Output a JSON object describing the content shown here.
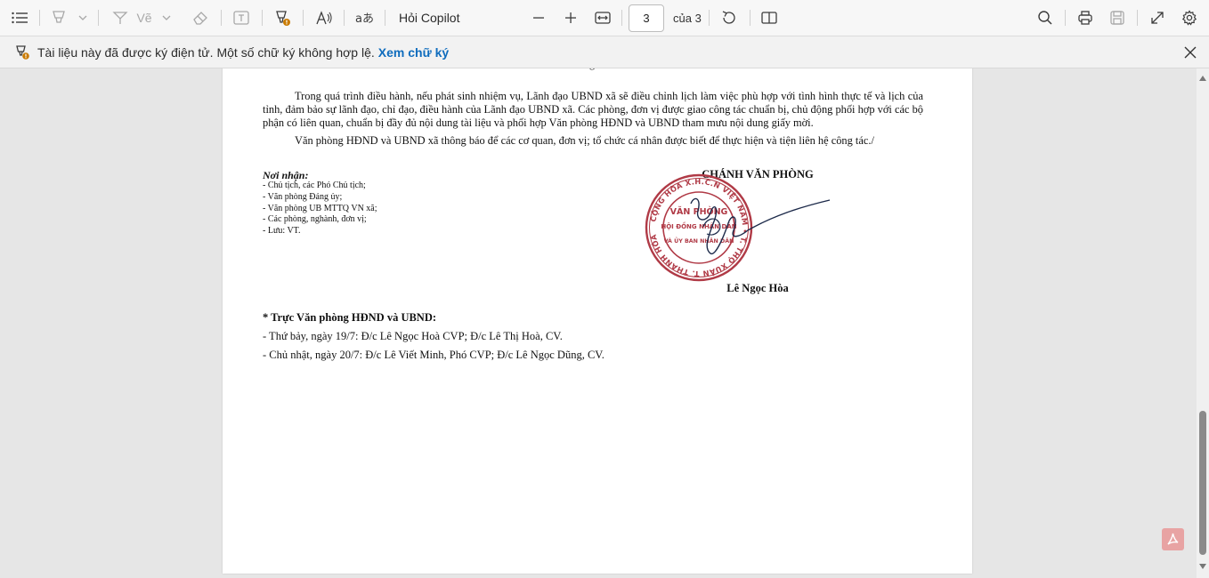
{
  "toolbar": {
    "ask_copilot_label": "Hỏi Copilot",
    "draw_label": "Vẽ",
    "page_number": "3",
    "page_total_label": "của 3"
  },
  "infobar": {
    "message": "Tài liệu này đã được ký điện tử. Một số chữ ký không hợp lệ.",
    "link_label": "Xem chữ ký"
  },
  "document": {
    "partial_top_char": "g",
    "paragraph_1": "Trong quá trình điều hành, nếu phát sinh nhiệm vụ, Lãnh đạo UBND xã sẽ điều chỉnh lịch làm việc phù hợp với tình hình thực tế và lịch của tỉnh, đảm bảo sự lãnh đạo, chỉ đạo, điều hành của Lãnh đạo UBND xã. Các phòng, đơn vị được giao công tác chuẩn bị, chủ động phối hợp với các bộ phận có liên quan, chuẩn bị đầy đủ nội dung tài liệu và phối hợp Văn phòng HĐND và UBND tham mưu nội dung giấy mời.",
    "paragraph_2": "Văn phòng HĐND và UBND xã thông báo để các cơ quan, đơn vị; tổ chức cá nhân được biết để thực hiện và tiện liên hệ công tác./",
    "recipients_title": "Nơi nhận:",
    "recipients": [
      "- Chủ tịch, các Phó Chủ tịch;",
      "- Văn phòng Đảng ủy;",
      "- Văn phòng UB MTTQ VN xã;",
      "- Các phòng, nghành, đơn vị;",
      "- Lưu: VT."
    ],
    "signer_title": "CHÁNH VĂN PHÒNG",
    "signer_name": "Lê Ngọc Hòa",
    "stamp": {
      "outer_text": "CỘNG HÒA X.H.C.N VIỆT NAM • T. THỌ XUÂN T. THANH HÓA",
      "line1": "VĂN PHÒNG",
      "line2": "HỘI ĐỒNG NHÂN DÂN",
      "line3": "VÀ ỦY BAN NHÂN DÂN"
    },
    "duty_title": "* Trực Văn phòng HĐND và UBND:",
    "duty_lines": [
      "- Thứ bảy, ngày 19/7: Đ/c Lê Ngọc Hoà CVP; Đ/c Lê Thị Hoà, CV.",
      "- Chủ nhật, ngày 20/7: Đ/c Lê Viết Minh, Phó CVP; Đ/c Lê Ngọc Dũng, CV."
    ]
  },
  "colors": {
    "link": "#0f6cbd",
    "stamp": "#b03a46",
    "signature_ink": "#1d2a4a"
  }
}
